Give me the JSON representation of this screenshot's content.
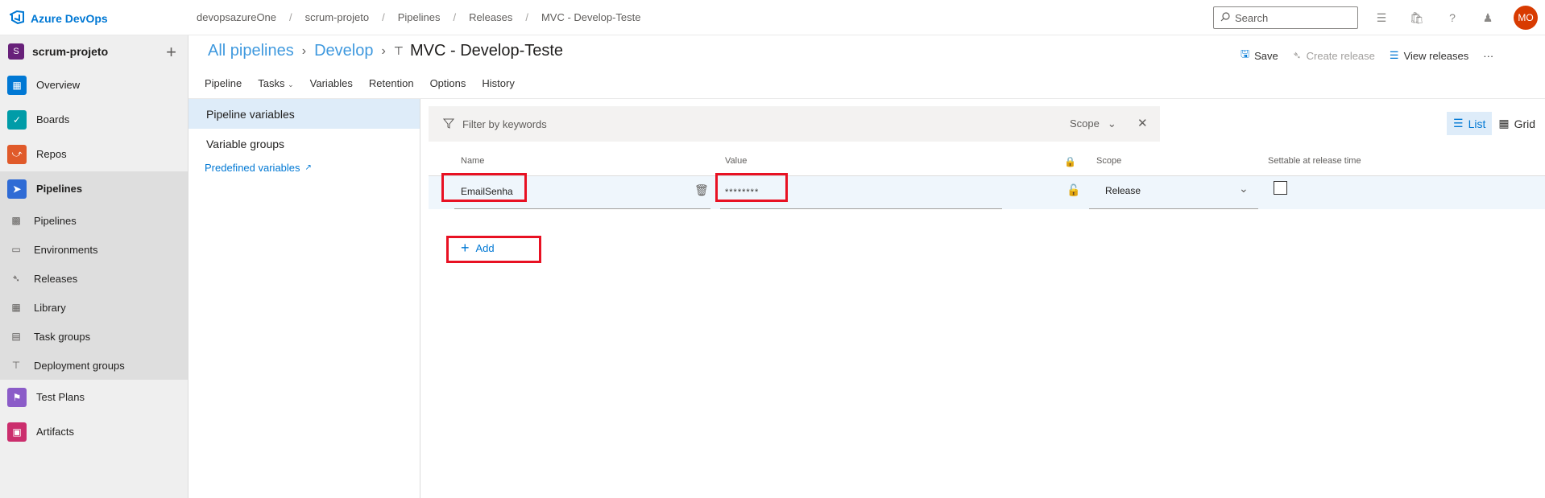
{
  "topbar": {
    "brand": "Azure DevOps",
    "breadcrumbs": [
      "devopsazureOne",
      "scrum-projeto",
      "Pipelines",
      "Releases",
      "MVC - Develop-Teste"
    ],
    "search_placeholder": "Search",
    "avatar_initials": "MO"
  },
  "leftnav": {
    "project_initial": "S",
    "project_name": "scrum-projeto",
    "items": [
      {
        "label": "Overview"
      },
      {
        "label": "Boards"
      },
      {
        "label": "Repos"
      },
      {
        "label": "Pipelines"
      }
    ],
    "subitems": [
      {
        "label": "Pipelines"
      },
      {
        "label": "Environments"
      },
      {
        "label": "Releases"
      },
      {
        "label": "Library"
      },
      {
        "label": "Task groups"
      },
      {
        "label": "Deployment groups"
      }
    ],
    "bottom_items": [
      {
        "label": "Test Plans"
      },
      {
        "label": "Artifacts"
      }
    ]
  },
  "header": {
    "crumb1": "All pipelines",
    "crumb2": "Develop",
    "title": "MVC - Develop-Teste",
    "save": "Save",
    "create_release": "Create release",
    "view_releases": "View releases",
    "more": "···"
  },
  "tabs": [
    "Pipeline",
    "Tasks",
    "Variables",
    "Retention",
    "Options",
    "History"
  ],
  "varpanel": {
    "pipeline_variables": "Pipeline variables",
    "variable_groups": "Variable groups",
    "predefined": "Predefined variables"
  },
  "filter": {
    "placeholder": "Filter by keywords",
    "scope": "Scope",
    "view_list": "List",
    "view_grid": "Grid"
  },
  "grid": {
    "col_name": "Name",
    "col_value": "Value",
    "col_scope": "Scope",
    "col_settable": "Settable at release time",
    "row": {
      "name": "EmailSenha",
      "value": "********",
      "scope": "Release"
    },
    "add": "Add"
  },
  "colors": {
    "accent": "#0078d4",
    "highlight_border": "#e81123",
    "avatar": "#d83b01"
  }
}
